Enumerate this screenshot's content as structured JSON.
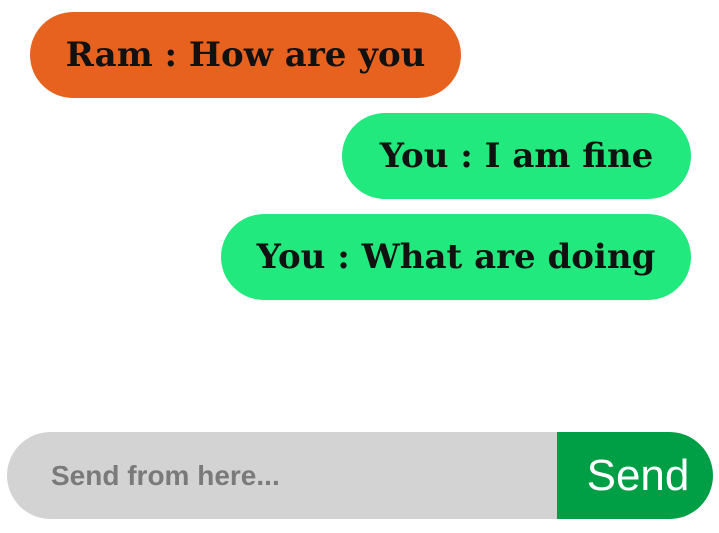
{
  "messages": [
    {
      "sender": "Ram",
      "text": "Ram : How are you",
      "direction": "incoming",
      "color": "#e8621f"
    },
    {
      "sender": "You",
      "text": "You : I am fine",
      "direction": "outgoing",
      "color": "#22e97d"
    },
    {
      "sender": "You",
      "text": "You : What are doing",
      "direction": "outgoing",
      "color": "#22e97d"
    }
  ],
  "composer": {
    "placeholder": "Send from here...",
    "value": "",
    "send_label": "Send",
    "input_color": "#d3d3d3",
    "send_color": "#009e45"
  }
}
